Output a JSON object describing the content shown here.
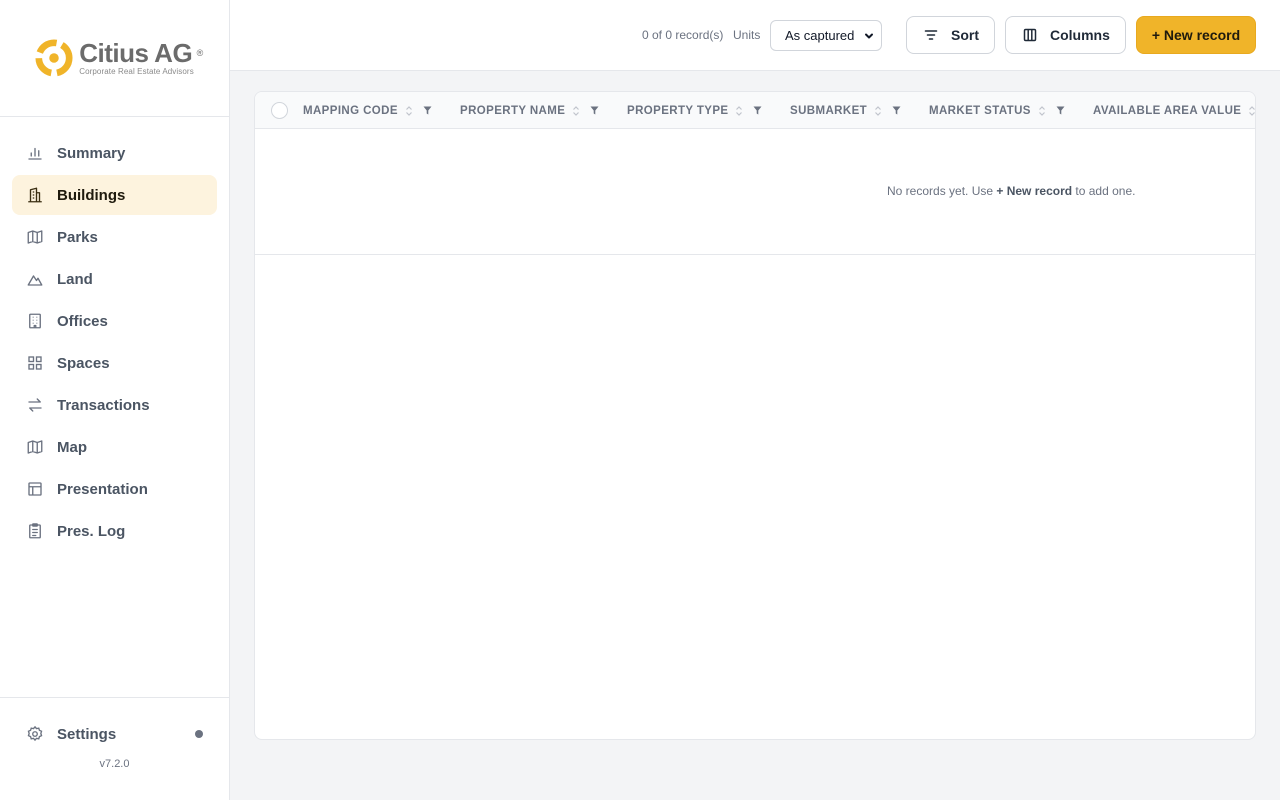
{
  "brand": {
    "name": "Citius AG",
    "registered": "®",
    "tagline": "Corporate Real Estate Advisors",
    "accent_color": "#f0b429"
  },
  "sidebar": {
    "items": [
      {
        "label": "Summary",
        "icon": "bar-chart-icon",
        "active": false
      },
      {
        "label": "Buildings",
        "icon": "building-icon",
        "active": true
      },
      {
        "label": "Parks",
        "icon": "map-fold-icon",
        "active": false
      },
      {
        "label": "Land",
        "icon": "mountain-icon",
        "active": false
      },
      {
        "label": "Offices",
        "icon": "office-building-icon",
        "active": false
      },
      {
        "label": "Spaces",
        "icon": "grid-icon",
        "active": false
      },
      {
        "label": "Transactions",
        "icon": "arrows-swap-icon",
        "active": false
      },
      {
        "label": "Map",
        "icon": "map-icon",
        "active": false
      },
      {
        "label": "Presentation",
        "icon": "layout-icon",
        "active": false
      },
      {
        "label": "Pres. Log",
        "icon": "clipboard-icon",
        "active": false
      }
    ],
    "settings_label": "Settings",
    "version": "v7.2.0"
  },
  "toolbar": {
    "record_count": "0 of 0 record(s)",
    "units_label": "Units",
    "units_value": "As captured",
    "sort_label": "Sort",
    "columns_label": "Columns",
    "new_record_label": "+ New record"
  },
  "table": {
    "columns": [
      "MAPPING CODE",
      "PROPERTY NAME",
      "PROPERTY TYPE",
      "SUBMARKET",
      "MARKET STATUS",
      "AVAILABLE AREA VALUE"
    ],
    "empty_prefix": "No records yet. Use ",
    "empty_action": "+ New record",
    "empty_suffix": " to add one."
  }
}
